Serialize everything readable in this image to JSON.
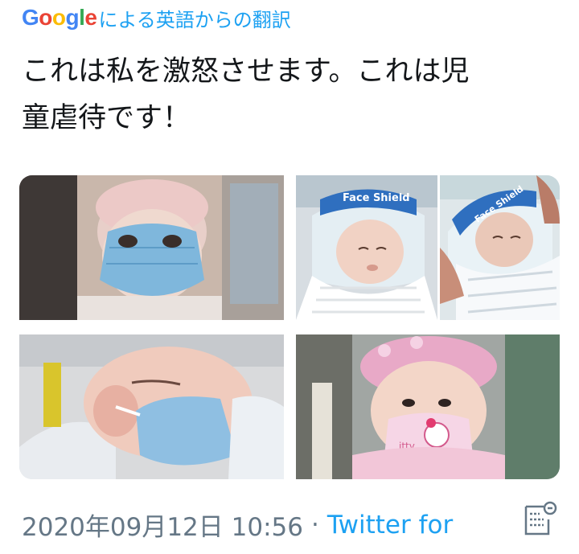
{
  "translation": {
    "google_logo": [
      "G",
      "o",
      "o",
      "g",
      "l",
      "e"
    ],
    "logo_colors": [
      "#4285F4",
      "#EA4335",
      "#FBBC05",
      "#4285F4",
      "#34A853",
      "#EA4335"
    ],
    "label": "による英語からの翻訳"
  },
  "tweet": {
    "text_line1": "これは私を激怒させます。これは児",
    "text_line2": "童虐待です！"
  },
  "media": {
    "images": [
      {
        "subject": "baby-face-mask-pink-hat"
      },
      {
        "subject": "newborn-face-shield",
        "shield_text": "Face Shield"
      },
      {
        "subject": "newborn-face-shield-held",
        "shield_text": "Face Shield"
      },
      {
        "subject": "sleeping-baby-blue-mask"
      },
      {
        "subject": "baby-hello-kitty-mask",
        "mask_text": "itty"
      }
    ]
  },
  "meta": {
    "timestamp": "2020年09月12日 10:56",
    "separator": "·",
    "source": "Twitter for"
  },
  "icons": {
    "details": "tweet-details-icon"
  }
}
